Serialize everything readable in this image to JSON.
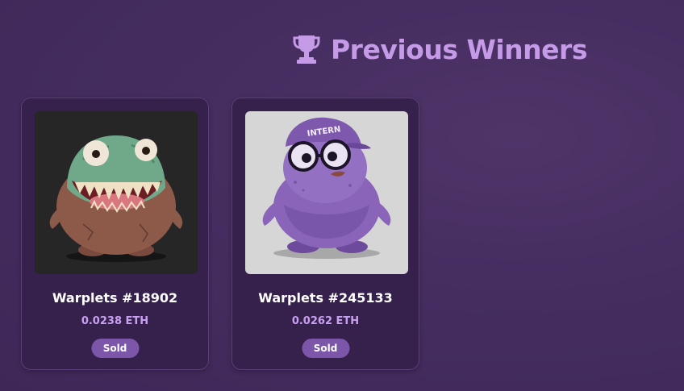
{
  "header": {
    "title": "Previous Winners",
    "icon": "trophy-icon",
    "accent_color": "#c59ae6"
  },
  "winners": [
    {
      "name": "Warplets #18902",
      "price": "0.0238 ETH",
      "status": "Sold",
      "art": "green-monster-illustration",
      "art_background": "#262626"
    },
    {
      "name": "Warplets #245133",
      "price": "0.0262 ETH",
      "status": "Sold",
      "art": "purple-intern-creature-illustration",
      "art_background": "#d6d6d6",
      "art_text": "INTERN"
    }
  ]
}
